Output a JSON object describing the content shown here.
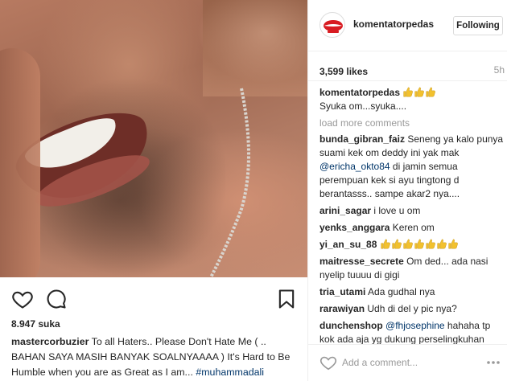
{
  "post": {
    "likes_left": "8.947 suka",
    "caption": {
      "user": "mastercorbuzier",
      "text": "To all Haters.. Please Don't Hate Me ( .. BAHAN SAYA MASIH BANYAK SOALNYAAAA ) It's Hard to Be Humble when you are as Great as I am... ",
      "hashtag": "#muhammadali"
    }
  },
  "header": {
    "username": "komentatorpedas",
    "follow_label": "Following"
  },
  "meta": {
    "likes": "3,599 likes",
    "time": "5h"
  },
  "comments": {
    "owner": {
      "user": "komentatorpedas",
      "text": "Syuka om...syuka...."
    },
    "load_more": "load more comments",
    "items": [
      {
        "user": "bunda_gibran_faiz",
        "pre": " Seneng ya kalo punya suami kek om deddy ini yak mak ",
        "mention": "@ericha_okto84",
        "post": " di jamin semua perempuan kek si ayu tingtong d berantasss.. sampe akar2 nya...."
      },
      {
        "user": "arini_sagar",
        "pre": " i love u om",
        "mention": "",
        "post": ""
      },
      {
        "user": "yenks_anggara",
        "pre": " Keren om",
        "mention": "",
        "post": ""
      },
      {
        "user": "yi_an_su_88",
        "pre": " ",
        "mention": "",
        "post": ""
      },
      {
        "user": "maitresse_secrete",
        "pre": " Om ded... ada nasi nyelip tuuuu di gigi",
        "mention": "",
        "post": ""
      },
      {
        "user": "tria_utami",
        "pre": " Ada gudhal nya",
        "mention": "",
        "post": ""
      },
      {
        "user": "rarawiyan",
        "pre": " Udh di del y pic nya?",
        "mention": "",
        "post": ""
      },
      {
        "user": "dunchenshop",
        "pre": " ",
        "mention": "@fhjosephine",
        "post": " hahaha tp kok ada aja yg dukung perselingkuhan mreka yaa, contohnya balajeeer ,,, apa"
      }
    ]
  },
  "add_comment": {
    "placeholder": "Add a comment..."
  },
  "icons": {
    "like": "heart-outline-icon",
    "comment": "speech-bubble-icon",
    "save": "bookmark-icon",
    "more": "more-options-icon",
    "emoji": "thumbs-up-emoji"
  },
  "colors": {
    "link": "#003569",
    "muted": "#999999",
    "border": "#dbdbdb"
  }
}
